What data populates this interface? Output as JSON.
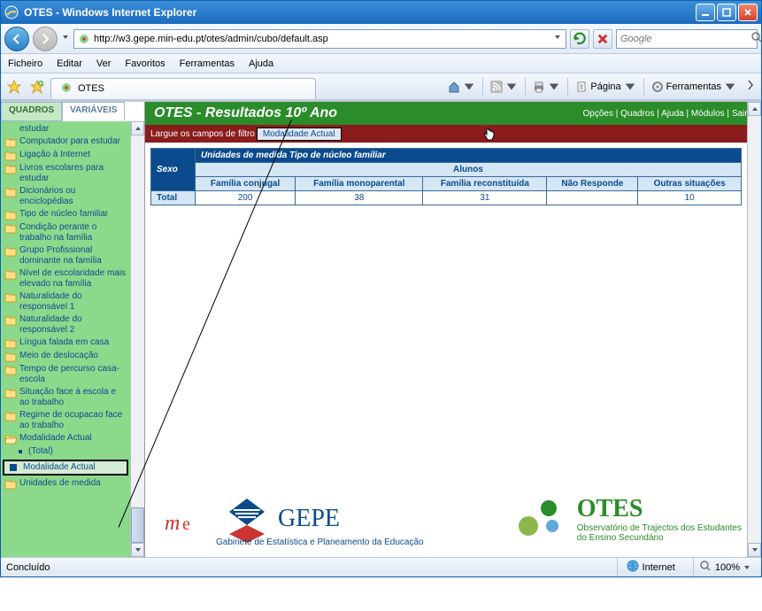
{
  "window": {
    "title": "OTES - Windows Internet Explorer"
  },
  "nav": {
    "url": "http://w3.gepe.min-edu.pt/otes/admin/cubo/default.asp",
    "search_placeholder": "Google"
  },
  "menubar": [
    "Ficheiro",
    "Editar",
    "Ver",
    "Favoritos",
    "Ferramentas",
    "Ajuda"
  ],
  "tab": {
    "title": "OTES"
  },
  "toolbar": {
    "page": "Página",
    "tools": "Ferramentas"
  },
  "sidebar": {
    "tabs": {
      "quadros": "QUADROS",
      "variaveis": "VARIÁVEIS"
    },
    "items": [
      "estudar",
      "Computador para estudar",
      "Ligação à Internet",
      "Livros escolares para estudar",
      "Dicionários ou enciclopédias",
      "Tipo de núcleo familiar",
      "Condição perante o trabalho na família",
      "Grupo Profissional dominante na família",
      "Nível de escolaridade mais elevado na família",
      "Naturalidade do responsável 1",
      "Naturalidade do responsável 2",
      "Língua falada em casa",
      "Meio de deslocação",
      "Tempo de percurso casa-escola",
      "Situação face à escola e ao trabalho",
      "Regime de ocupacao face ao trabalho",
      "Modalidade Actual",
      "(Total)",
      "Modalidade Actual",
      "Unidades de medida"
    ]
  },
  "page": {
    "title": "OTES - Resultados 10º Ano",
    "links": [
      "Opções",
      "Quadros",
      "Ajuda",
      "Módulos",
      "Sair"
    ],
    "filter_hint": "Largue os campos de filtro",
    "drag_chip": "Modalidade Actual",
    "grid": {
      "col_group1": "Unidades de medida",
      "col_group2": "Tipo de núcleo familiar",
      "sub_header": "Alunos",
      "row_header": "Sexo",
      "cols": [
        "Família conjugal",
        "Família monoparental",
        "Família reconstituída",
        "Não Responde",
        "Outras situações"
      ],
      "rows": [
        {
          "label": "Total",
          "values": [
            "200",
            "38",
            "31",
            "",
            "10"
          ]
        }
      ]
    },
    "gepe_sub": "Gabinete de Estatística e Planeamento da Educação",
    "otes_sub1": "Observatório de Trajectos dos Estudantes",
    "otes_sub2": "do Ensino Secundário"
  },
  "status": {
    "left": "Concluído",
    "zone": "Internet",
    "zoom": "100%"
  }
}
